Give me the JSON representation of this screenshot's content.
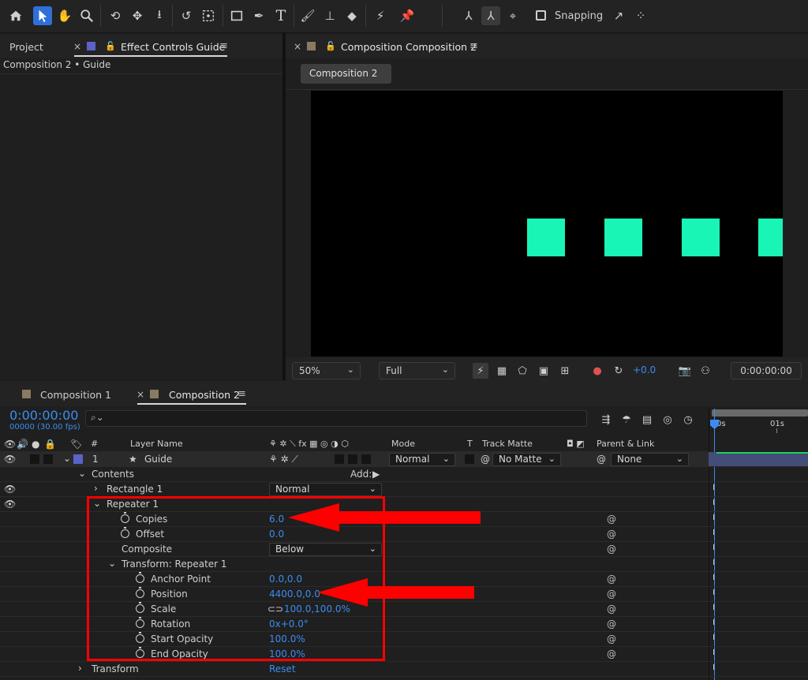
{
  "toolbar": {
    "snapping_label": "Snapping",
    "text_tool_glyph": "T"
  },
  "left_panel": {
    "tab_project": "Project",
    "tab_effect_controls": "Effect Controls Guide",
    "subtitle": "Composition 2 • Guide"
  },
  "viewer": {
    "tab_label": "Composition Composition 2",
    "crumb": "Composition 2",
    "zoom": "50%",
    "resolution": "Full",
    "exposure": "+0.0",
    "timecode": "0:00:00:00"
  },
  "composition_content": {
    "background_color": "#000000",
    "square_color": "#19f5b4",
    "visible_copies": 4
  },
  "timeline": {
    "tab1": "Composition 1",
    "tab2": "Composition 2",
    "timecode": "0:00:00:00",
    "fps": "00000 (30.00 fps)",
    "ruler": [
      "0s",
      "01s"
    ],
    "headers": {
      "num": "#",
      "layer_name": "Layer Name",
      "mode": "Mode",
      "t": "T",
      "track_matte": "Track Matte",
      "parent": "Parent & Link"
    },
    "layer": {
      "index": "1",
      "name": "Guide",
      "mode": "Normal",
      "matte": "No Matte",
      "parent": "None"
    },
    "props": {
      "contents": "Contents",
      "add": "Add:",
      "rectangle": "Rectangle 1",
      "rectangle_mode": "Normal",
      "repeater": "Repeater 1",
      "copies_label": "Copies",
      "copies": "6.0",
      "offset_label": "Offset",
      "offset": "0.0",
      "composite_label": "Composite",
      "composite": "Below",
      "transform_repeater": "Transform: Repeater 1",
      "anchor_label": "Anchor Point",
      "anchor": "0.0,0.0",
      "position_label": "Position",
      "position": "4400.0,0.0",
      "scale_label": "Scale",
      "scale": "100.0,100.0%",
      "rotation_label": "Rotation",
      "rotation": "0x+0.0°",
      "start_opacity_label": "Start Opacity",
      "start_opacity": "100.0%",
      "end_opacity_label": "End Opacity",
      "end_opacity": "100.0%",
      "transform": "Transform",
      "reset": "Reset"
    }
  },
  "annotation": {
    "color": "#ff0000"
  }
}
